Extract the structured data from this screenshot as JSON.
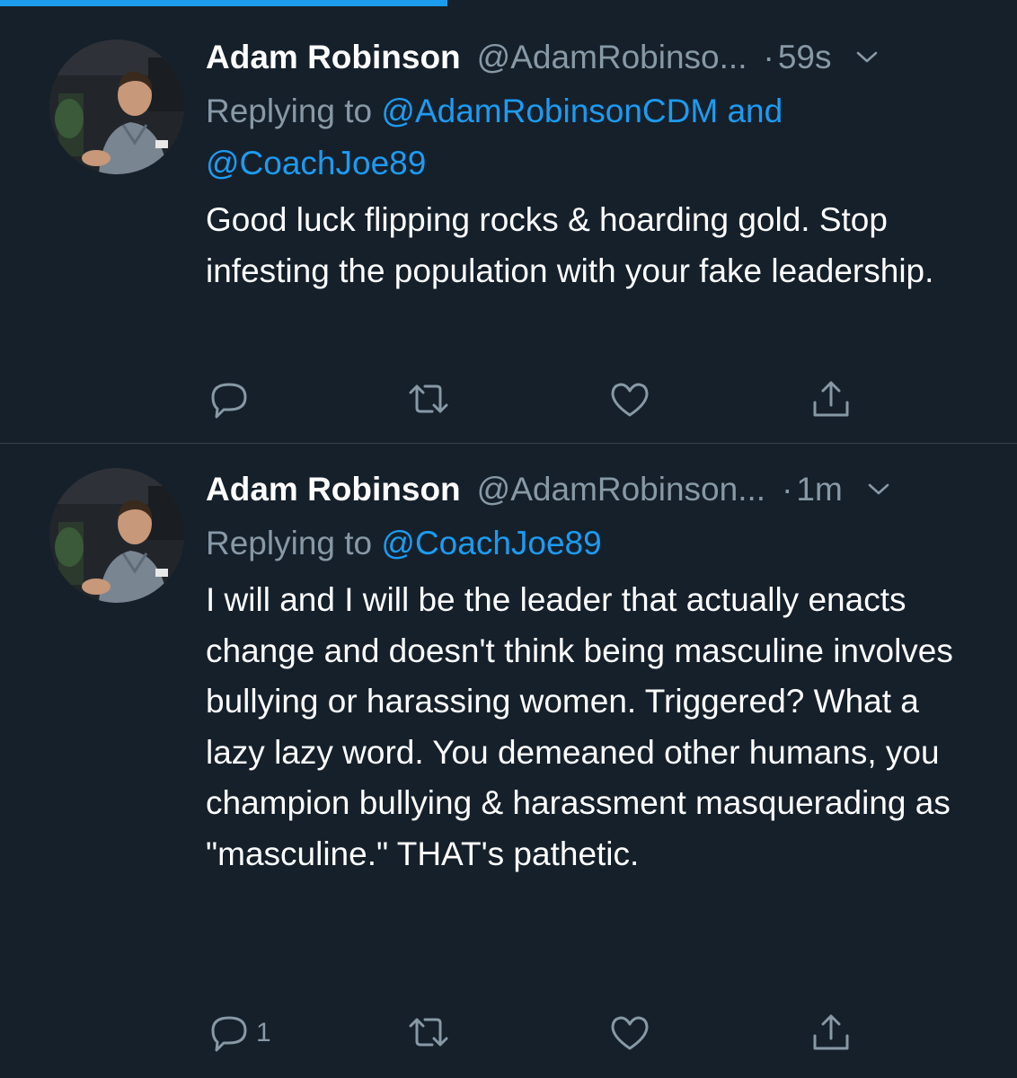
{
  "colors": {
    "background": "#15202b",
    "divider": "#38444d",
    "text_primary": "#ffffff",
    "text_secondary": "#8899a6",
    "link": "#1d9bf0",
    "progress": "#1d9bf0"
  },
  "loading_progress": 0.44,
  "tweets": [
    {
      "name": "Adam Robinson",
      "handle": "@AdamRobinso...",
      "separator": "·",
      "time": "59s",
      "replying_label": "Replying to",
      "replying_mentions": "@AdamRobinsonCDM and @CoachJoe89",
      "text": "Good luck flipping rocks & hoarding gold. Stop infesting the population with your fake leadership.",
      "reply_count": "",
      "icons": [
        "avatar",
        "chevron-down-icon",
        "reply-icon",
        "retweet-icon",
        "like-icon",
        "share-icon"
      ]
    },
    {
      "name": "Adam Robinson",
      "handle": "@AdamRobinson...",
      "separator": "·",
      "time": "1m",
      "replying_label": "Replying to",
      "replying_mentions": "@CoachJoe89",
      "text": "I will and I will be the leader that actually enacts change and doesn't think being masculine involves bullying or harassing women. Triggered? What a lazy lazy word. You demeaned other humans, you champion bullying & harassment masquerading as \"masculine.\" THAT's pathetic.",
      "reply_count": "1",
      "icons": [
        "avatar",
        "chevron-down-icon",
        "reply-icon",
        "retweet-icon",
        "like-icon",
        "share-icon"
      ]
    }
  ]
}
